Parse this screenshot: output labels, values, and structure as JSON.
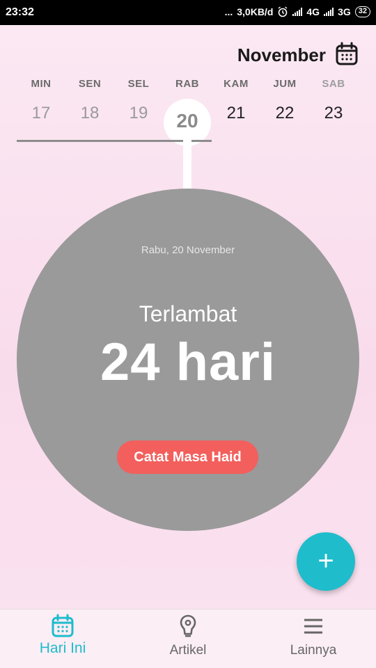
{
  "status_bar": {
    "time": "23:32",
    "dots": "...",
    "speed": "3,0KB/d",
    "network1": "4G",
    "network2": "3G",
    "battery": "32"
  },
  "header": {
    "month": "November",
    "calendar_icon": "calendar-icon"
  },
  "week": {
    "days": [
      {
        "name": "MIN",
        "num": "17"
      },
      {
        "name": "SEN",
        "num": "18"
      },
      {
        "name": "SEL",
        "num": "19"
      },
      {
        "name": "RAB",
        "num": "20"
      },
      {
        "name": "KAM",
        "num": "21"
      },
      {
        "name": "JUM",
        "num": "22"
      },
      {
        "name": "SAB",
        "num": "23"
      }
    ],
    "selected_index": 3
  },
  "main_circle": {
    "date": "Rabu, 20 November",
    "status": "Terlambat",
    "count": "24 hari",
    "cta": "Catat Masa Haid"
  },
  "fab": {
    "label": "+"
  },
  "bottom_nav": {
    "items": [
      {
        "label": "Hari Ini",
        "icon": "calendar-icon"
      },
      {
        "label": "Artikel",
        "icon": "lightbulb-icon"
      },
      {
        "label": "Lainnya",
        "icon": "menu-icon"
      }
    ],
    "active_index": 0
  },
  "colors": {
    "accent": "#1fbccc",
    "cta": "#f25f5c",
    "circle": "#9a9a9a",
    "background": "#fbe9f3"
  }
}
